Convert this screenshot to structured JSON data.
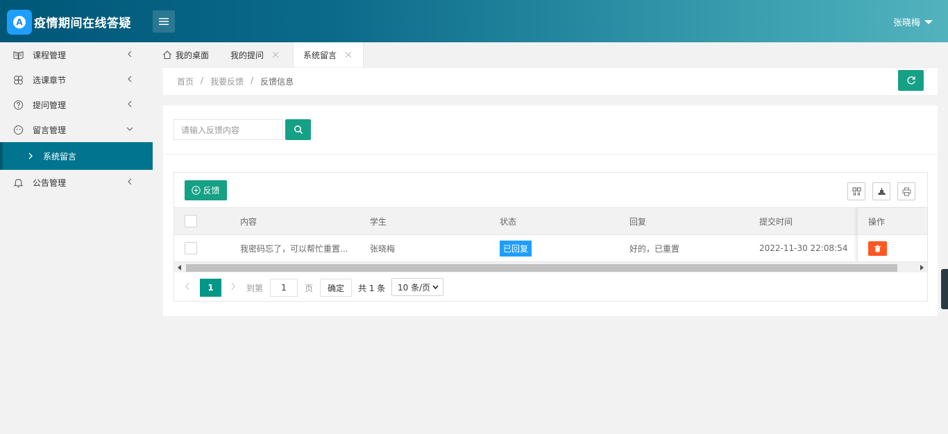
{
  "app": {
    "title": "疫情期间在线答疑",
    "logo_letter": "A"
  },
  "header": {
    "user_name": "张晓梅"
  },
  "sidebar": {
    "items": [
      {
        "label": "课程管理",
        "icon": "book-icon"
      },
      {
        "label": "选课章节",
        "icon": "clover-icon"
      },
      {
        "label": "提问管理",
        "icon": "question-icon"
      },
      {
        "label": "留言管理",
        "icon": "face-icon"
      },
      {
        "label": "系统留言",
        "icon": "chevron-right-icon"
      },
      {
        "label": "公告管理",
        "icon": "bell-icon"
      }
    ]
  },
  "tabs": [
    {
      "label": "我的桌面"
    },
    {
      "label": "我的提问"
    },
    {
      "label": "系统留言"
    }
  ],
  "breadcrumb": {
    "home": "首页",
    "sep": "/",
    "parent": "我要反馈",
    "current": "反馈信息"
  },
  "search": {
    "placeholder": "请输入反馈内容"
  },
  "toolbar": {
    "add_label": "反馈"
  },
  "table": {
    "columns": [
      "内容",
      "学生",
      "状态",
      "回复",
      "提交时间",
      "操作"
    ],
    "rows": [
      {
        "content": "我密码忘了，可以帮忙重置...",
        "student": "张晓梅",
        "status": "已回复",
        "reply": "好的，已重置",
        "time": "2022-11-30 22:08:54"
      }
    ]
  },
  "pagination": {
    "current": "1",
    "goto_label": "到第",
    "page_input": "1",
    "page_unit": "页",
    "confirm": "确定",
    "total": "共 1 条",
    "page_size": "10 条/页"
  },
  "colors": {
    "primary": "#16a085",
    "header_start": "#005778",
    "header_end": "#52b3bd",
    "active_nav": "#01748f",
    "badge": "#1e9fff",
    "danger": "#ff5722"
  }
}
